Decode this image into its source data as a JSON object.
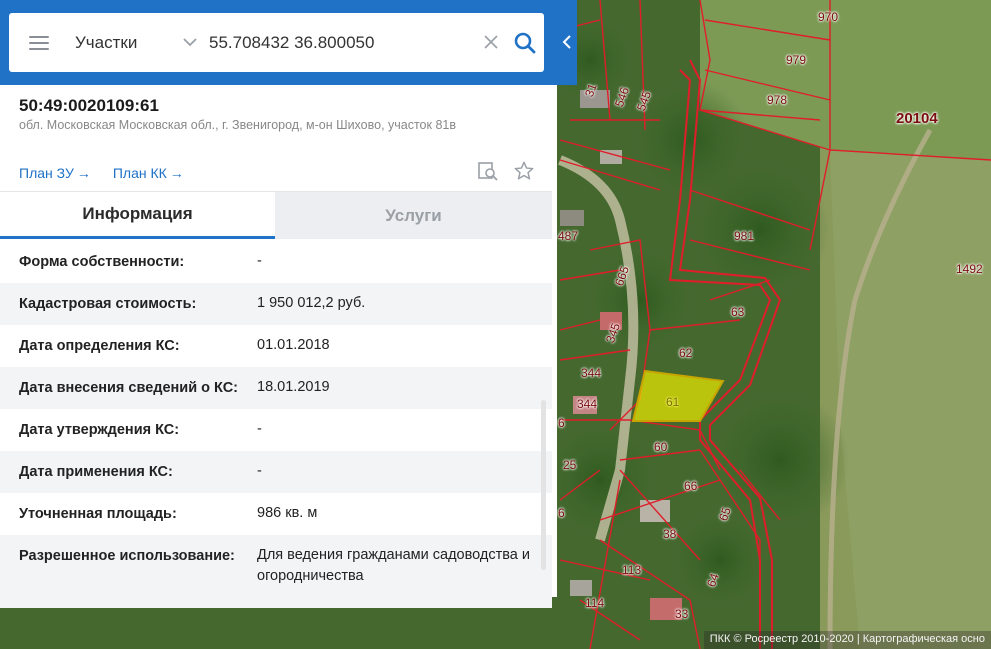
{
  "search": {
    "layer": "Участки",
    "query": "55.708432 36.800050"
  },
  "parcel": {
    "cad_number": "50:49:0020109:61",
    "address": "обл. Московская Московская обл., г. Звенигород, м-он Шихово, участок 81в"
  },
  "links": [
    {
      "label": "План ЗУ",
      "arrow": "→"
    },
    {
      "label": "План КК",
      "arrow": "→"
    }
  ],
  "tools": {
    "zoom_to": "zoom-search-icon",
    "favorite": "star-icon"
  },
  "tabs": [
    {
      "label": "Информация",
      "active": true
    },
    {
      "label": "Услуги",
      "active": false
    }
  ],
  "info": [
    {
      "key": "Форма собственности:",
      "value": "-"
    },
    {
      "key": "Кадастровая стоимость:",
      "value": "1 950 012,2 руб."
    },
    {
      "key": "Дата определения КС:",
      "value": "01.01.2018"
    },
    {
      "key": "Дата внесения сведений о КС:",
      "value": "18.01.2019"
    },
    {
      "key": "Дата утверждения КС:",
      "value": "-"
    },
    {
      "key": "Дата применения КС:",
      "value": "-"
    },
    {
      "key": "Уточненная площадь:",
      "value": "986 кв. м"
    },
    {
      "key": "Разрешенное использование:",
      "value": "Для ведения гражданами садоводства и огородничества"
    }
  ],
  "map": {
    "parcel_labels": [
      "970",
      "979",
      "978",
      "20104",
      "31",
      "546",
      "545",
      "981",
      "487",
      "665",
      "1492",
      "63",
      "345",
      "62",
      "344",
      "344",
      "61",
      "60",
      "25",
      "66",
      "65",
      "38",
      "113",
      "64",
      "114",
      "33",
      "6",
      "6"
    ],
    "attribution": "ПКК © Росреестр 2010-2020 | Картографическая осно"
  },
  "colors": {
    "brand": "#2072c7",
    "boundary": "#e01e2a",
    "selected_fill": "#e8e800"
  }
}
